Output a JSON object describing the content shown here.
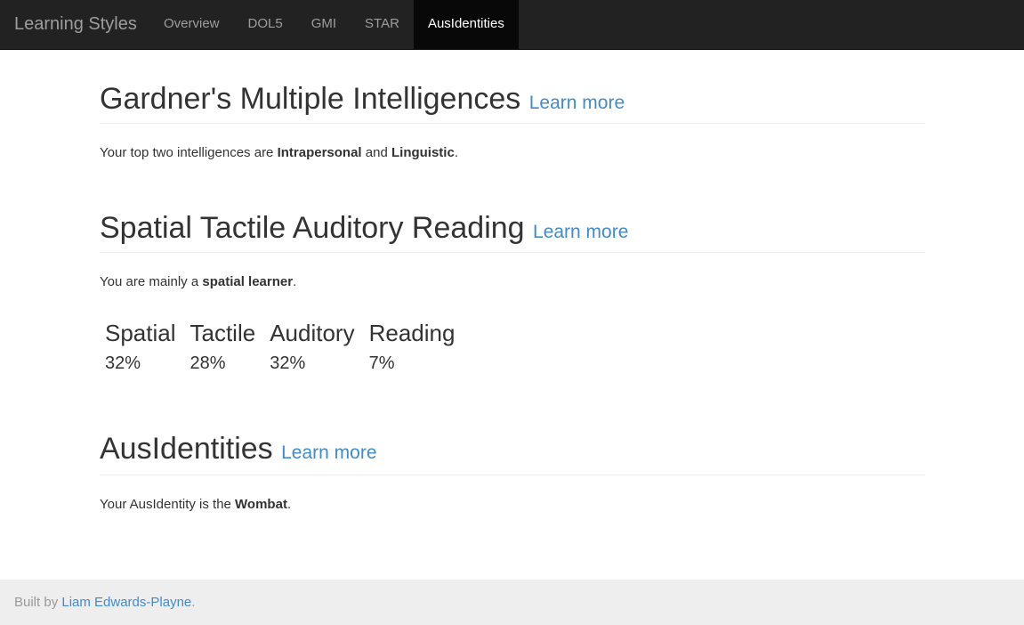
{
  "navbar": {
    "brand": "Learning Styles",
    "items": [
      {
        "label": "Overview"
      },
      {
        "label": "DOL5"
      },
      {
        "label": "GMI"
      },
      {
        "label": "STAR"
      },
      {
        "label": "AusIdentities",
        "active": true
      }
    ]
  },
  "sections": {
    "gmi": {
      "title": "Gardner's Multiple Intelligences",
      "learn_more": "Learn more",
      "text_prefix": "Your top two intelligences are ",
      "first": "Intrapersonal",
      "joiner": " and ",
      "second": "Linguistic",
      "suffix": "."
    },
    "star": {
      "title": "Spatial Tactile Auditory Reading",
      "learn_more": "Learn more",
      "text_prefix": "You are mainly a ",
      "highlight": "spatial learner",
      "suffix": ".",
      "stats": [
        {
          "name": "Spatial",
          "value": "32%"
        },
        {
          "name": "Tactile",
          "value": "28%"
        },
        {
          "name": "Auditory",
          "value": "32%"
        },
        {
          "name": "Reading",
          "value": "7%"
        }
      ]
    },
    "aus": {
      "title": "AusIdentities",
      "learn_more": "Learn more",
      "text_prefix": "Your AusIdentity is the ",
      "highlight": "Wombat",
      "suffix": "."
    }
  },
  "footer": {
    "prefix": "Built by ",
    "author": "Liam Edwards-Playne",
    "suffix": "."
  },
  "colors": {
    "navbar_bg": "#222222",
    "link": "#428bca",
    "footer_bg": "#eeeeee"
  }
}
